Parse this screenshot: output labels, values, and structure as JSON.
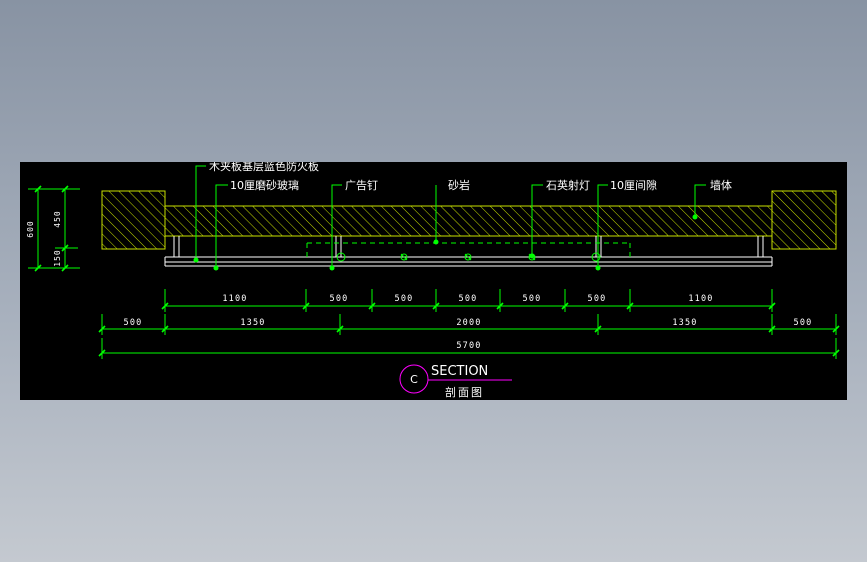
{
  "colors": {
    "canvas": "#000000",
    "line": "#00ff00",
    "hatch": "#c8e000",
    "text": "#ffffff",
    "marker": "#ff00ff"
  },
  "callouts": [
    {
      "label": "木夹板基层蓝色防火板"
    },
    {
      "label": "10厘磨砂玻璃"
    },
    {
      "label": "广告钉"
    },
    {
      "label": "砂岩"
    },
    {
      "label": "石英射灯"
    },
    {
      "label": "10厘间隙"
    },
    {
      "label": "墙体"
    }
  ],
  "dims": {
    "row1": [
      "1100",
      "500",
      "500",
      "500",
      "500",
      "500",
      "1100"
    ],
    "row2": [
      "500",
      "1350",
      "2000",
      "1350",
      "500"
    ],
    "total": "5700",
    "vertical_total": "600",
    "vertical_upper": "450",
    "vertical_lower": "150"
  },
  "title_block": {
    "marker": "C",
    "title": "SECTION",
    "subtitle": "剖面图"
  }
}
